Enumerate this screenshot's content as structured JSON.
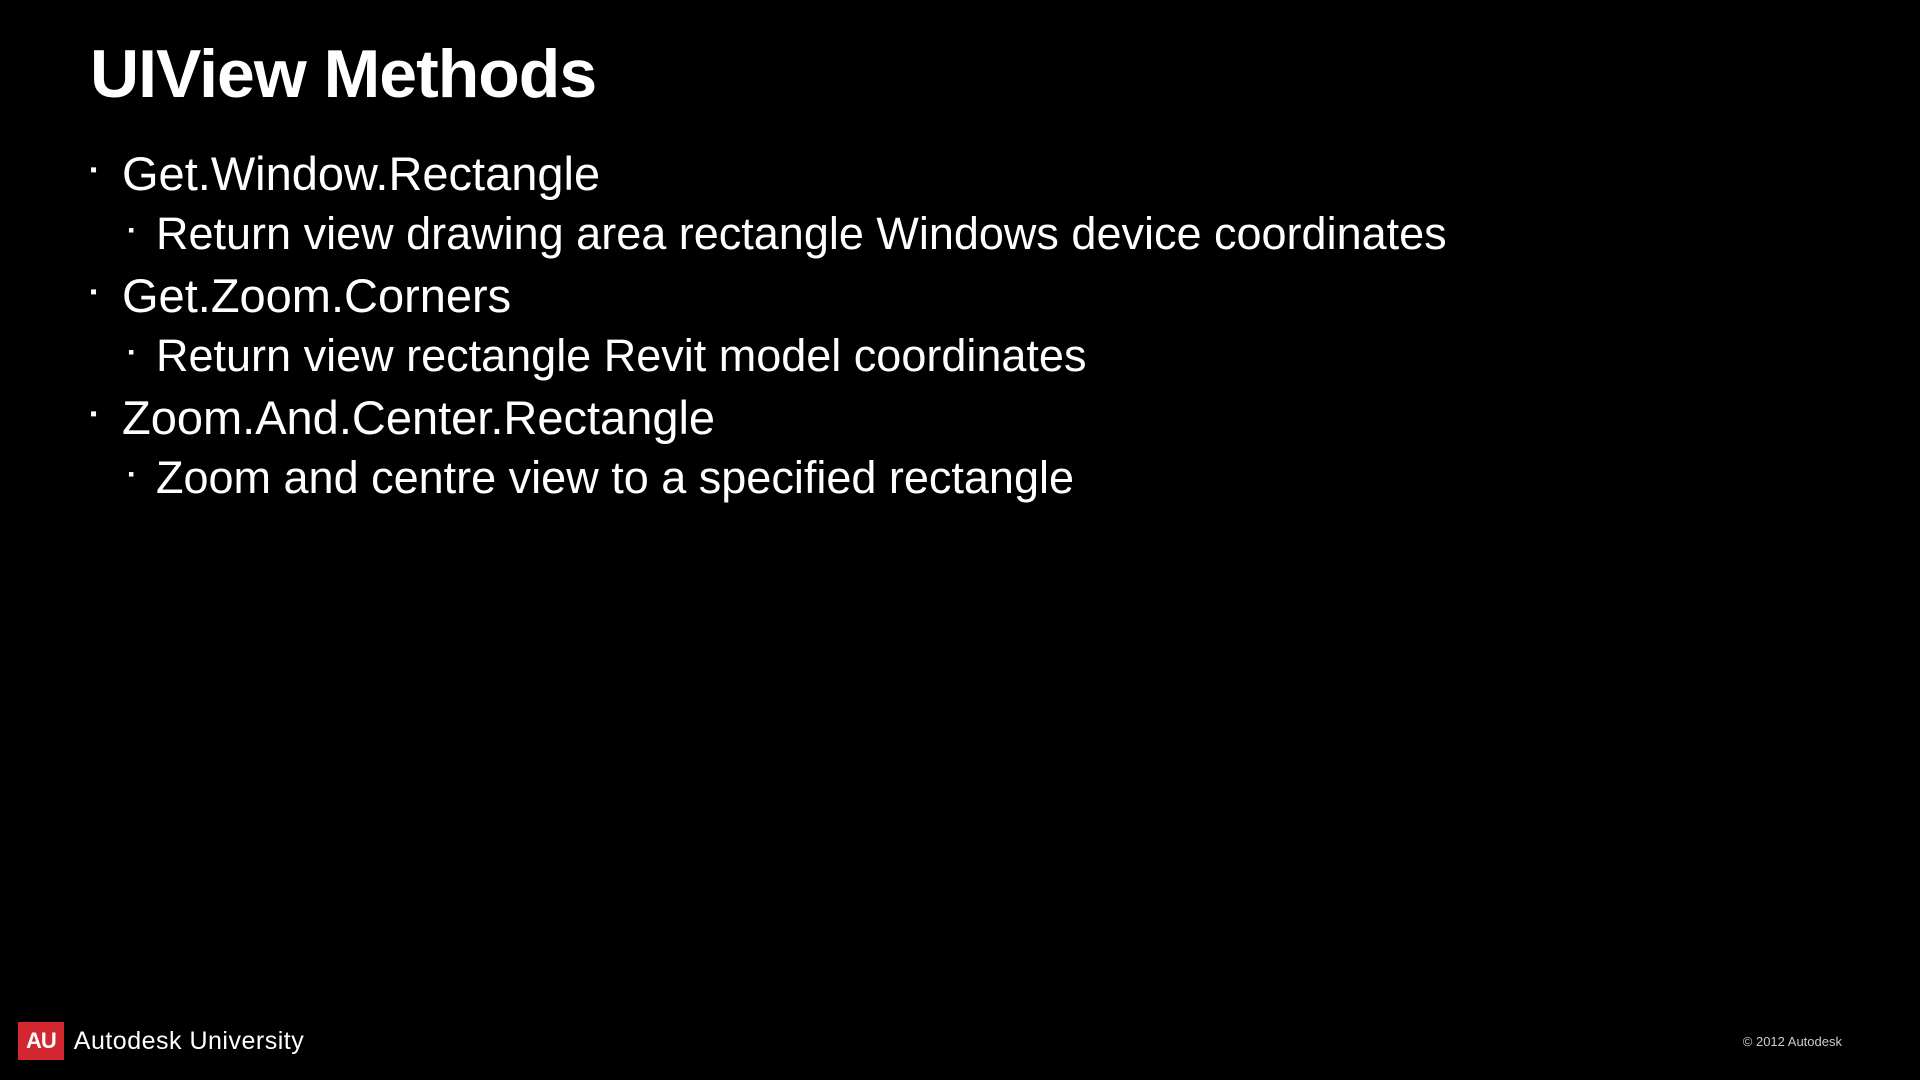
{
  "slide": {
    "title": "UIView Methods",
    "items": [
      {
        "level": 1,
        "text": "Get.Window.Rectangle"
      },
      {
        "level": 2,
        "text": "Return view drawing area rectangle Windows device coordinates"
      },
      {
        "level": 1,
        "text": "Get.Zoom.Corners"
      },
      {
        "level": 2,
        "text": "Return view rectangle Revit model coordinates"
      },
      {
        "level": 1,
        "text": "Zoom.And.Center.Rectangle"
      },
      {
        "level": 2,
        "text": "Zoom and centre view to a specified rectangle"
      }
    ]
  },
  "footer": {
    "logo_badge": "AU",
    "logo_text": "Autodesk University",
    "copyright": "© 2012 Autodesk"
  }
}
